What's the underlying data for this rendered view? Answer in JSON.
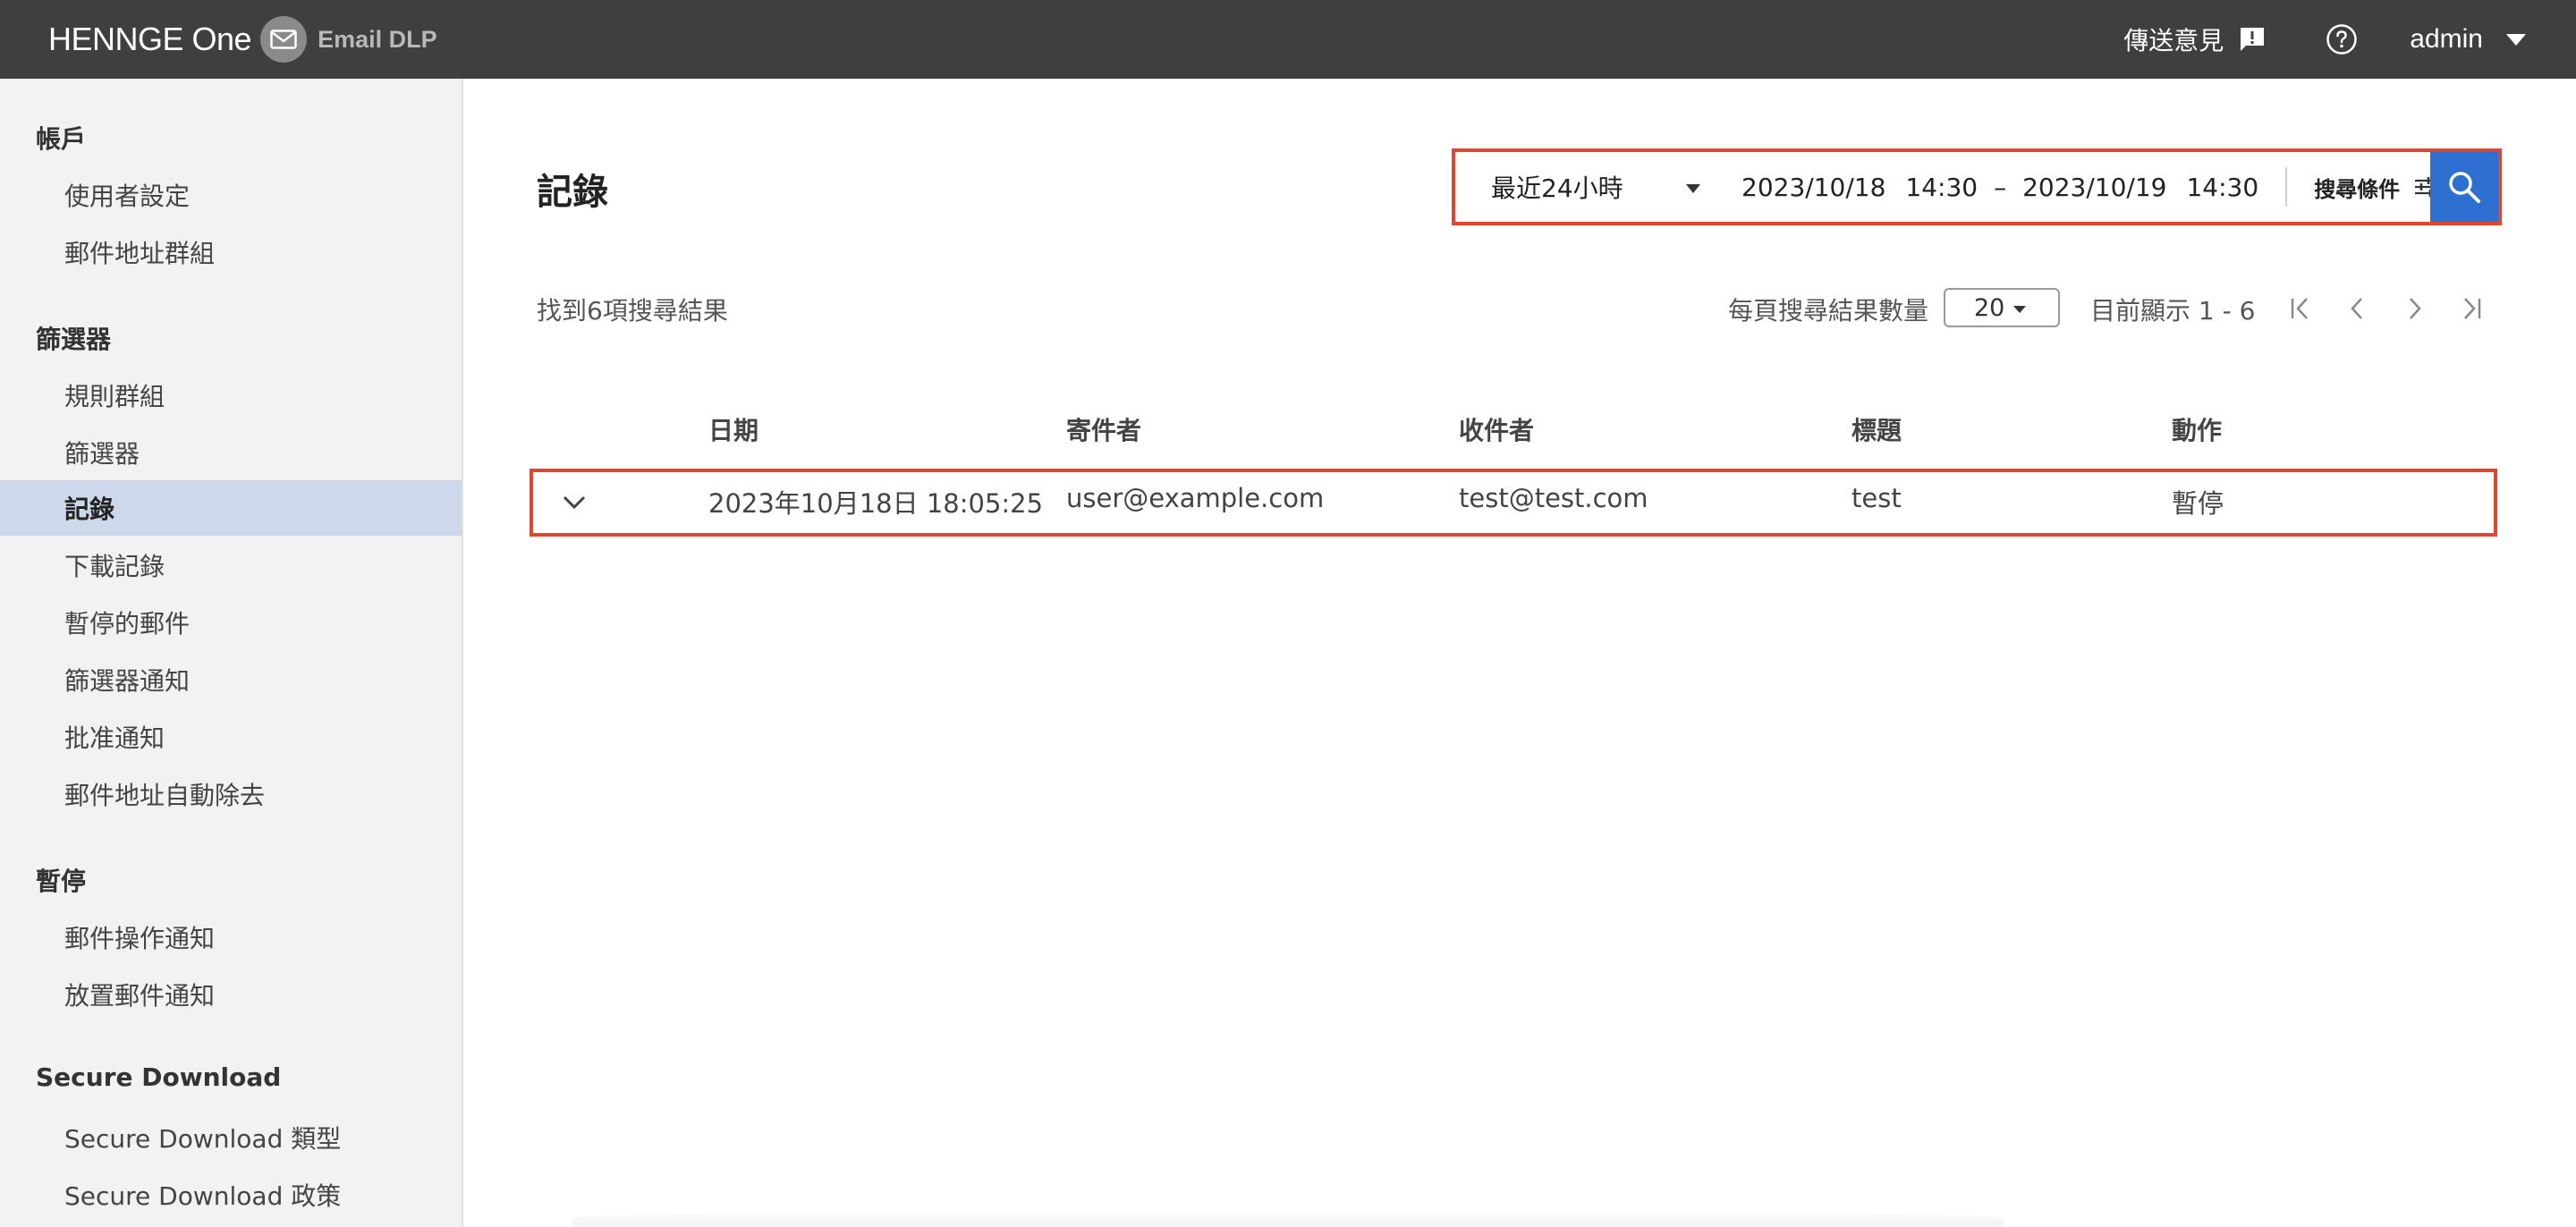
{
  "header": {
    "brand_main": "HENNGE One",
    "brand_product": "Email DLP",
    "feedback_label": "傳送意見",
    "user_label": "admin"
  },
  "sidebar": {
    "sections": [
      {
        "title": "帳戶",
        "items": [
          "使用者設定",
          "郵件地址群組"
        ]
      },
      {
        "title": "篩選器",
        "items": [
          "規則群組",
          "篩選器",
          "記錄",
          "下載記錄",
          "暫停的郵件",
          "篩選器通知",
          "批准通知",
          "郵件地址自動除去"
        ]
      },
      {
        "title": "暫停",
        "items": [
          "郵件操作通知",
          "放置郵件通知"
        ]
      },
      {
        "title": "Secure Download",
        "items": [
          "Secure Download 類型",
          "Secure Download 政策"
        ]
      }
    ],
    "active_item": "記錄"
  },
  "main": {
    "title": "記錄",
    "search": {
      "range_label": "最近24小時",
      "start_date": "2023/10/18",
      "start_time": "14:30",
      "separator": "–",
      "end_date": "2023/10/19",
      "end_time": "14:30",
      "criteria_label": "搜尋條件"
    },
    "results_count": "找到6項搜尋結果",
    "per_page_label": "每頁搜尋結果數量",
    "per_page_value": "20",
    "showing": "目前顯示 1 - 6",
    "table": {
      "columns": [
        "日期",
        "寄件者",
        "收件者",
        "標題",
        "動作"
      ],
      "rows": [
        {
          "date": "2023年10月18日 18:05:25",
          "sender": "user@example.com",
          "recipient": "test@test.com",
          "subject": "test",
          "action": "暫停"
        }
      ]
    }
  },
  "icons": {
    "mail": "envelope-icon",
    "feedback": "feedback-icon",
    "help": "help-icon",
    "search": "search-icon",
    "filter": "sliders-icon"
  },
  "colors": {
    "topbar": "#3f3f3f",
    "active_nav": "#cdd9ea",
    "search_button": "#2e6fd2",
    "highlight": "#e0452f"
  }
}
